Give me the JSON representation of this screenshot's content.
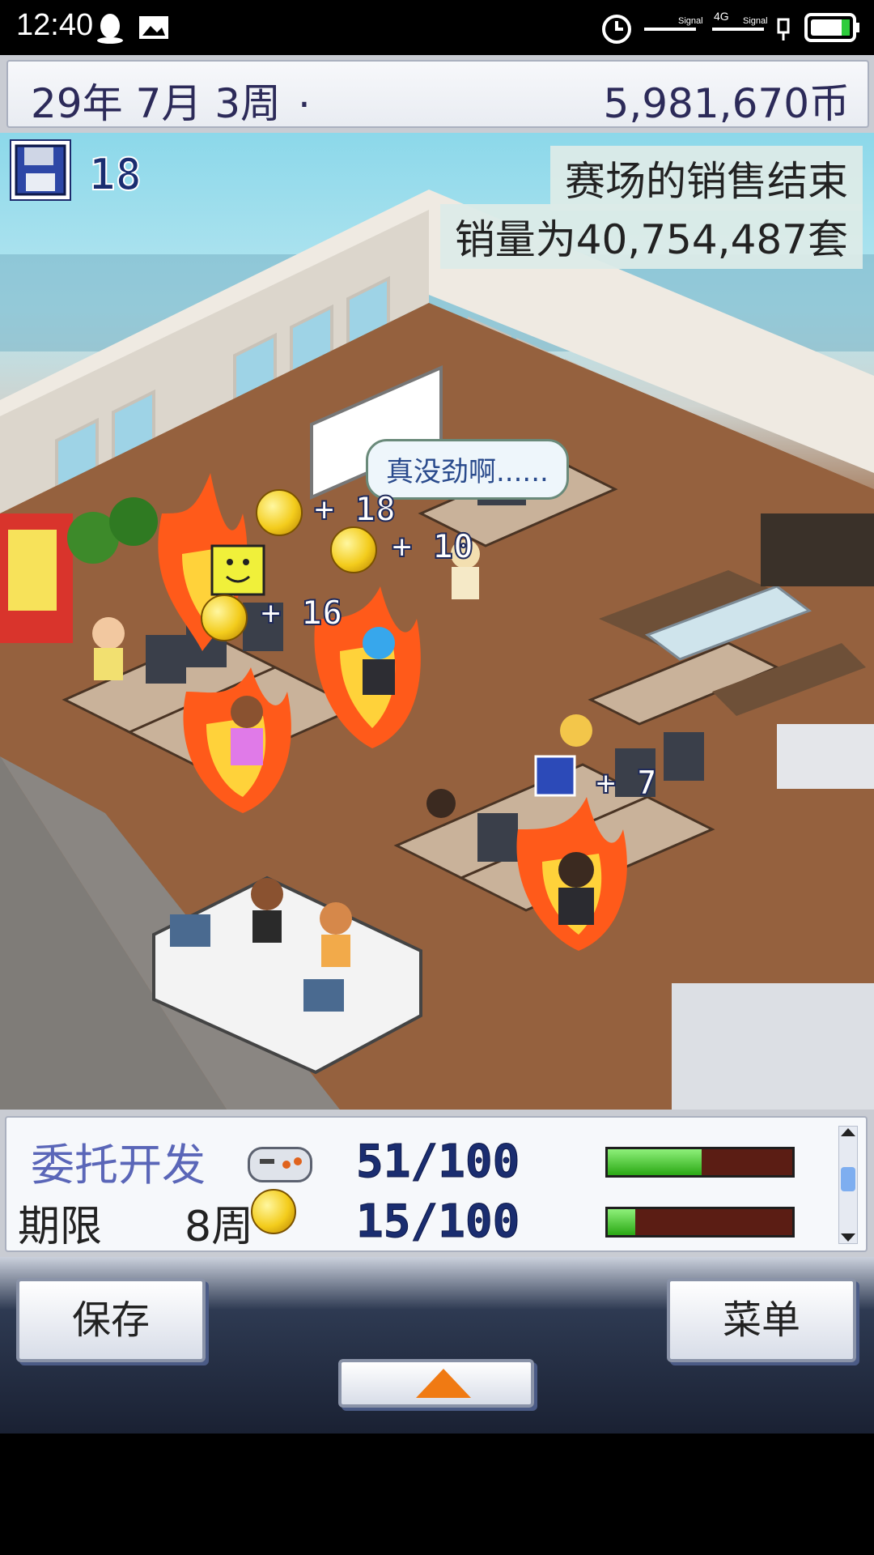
{
  "status_bar": {
    "time": "12:40",
    "signal_label_1": "Signal",
    "signal_label_2": "4G",
    "signal_label_3": "Signal"
  },
  "header": {
    "date": "29年 7月 3周",
    "money": "5,981,670币"
  },
  "scene": {
    "disk_count": "18",
    "notice_line1": "赛场的销售结束",
    "notice_line2": "销量为40,754,487套",
    "speech_bubble": "真没劲啊......",
    "popups": [
      "+ 18",
      "+ 10",
      "+ 16",
      "+ 7"
    ]
  },
  "info_panel": {
    "title": "委托开发",
    "deadline_label": "期限",
    "deadline_weeks": "8周",
    "progress_1": "51/100",
    "progress_2": "15/100",
    "progress_1_value": 0.51,
    "progress_2_value": 0.15
  },
  "controls": {
    "save_label": "保存",
    "menu_label": "菜单"
  },
  "colors": {
    "accent": "#1a2d70",
    "progress_fill": "#2aa814",
    "arrow": "#f07a13"
  }
}
